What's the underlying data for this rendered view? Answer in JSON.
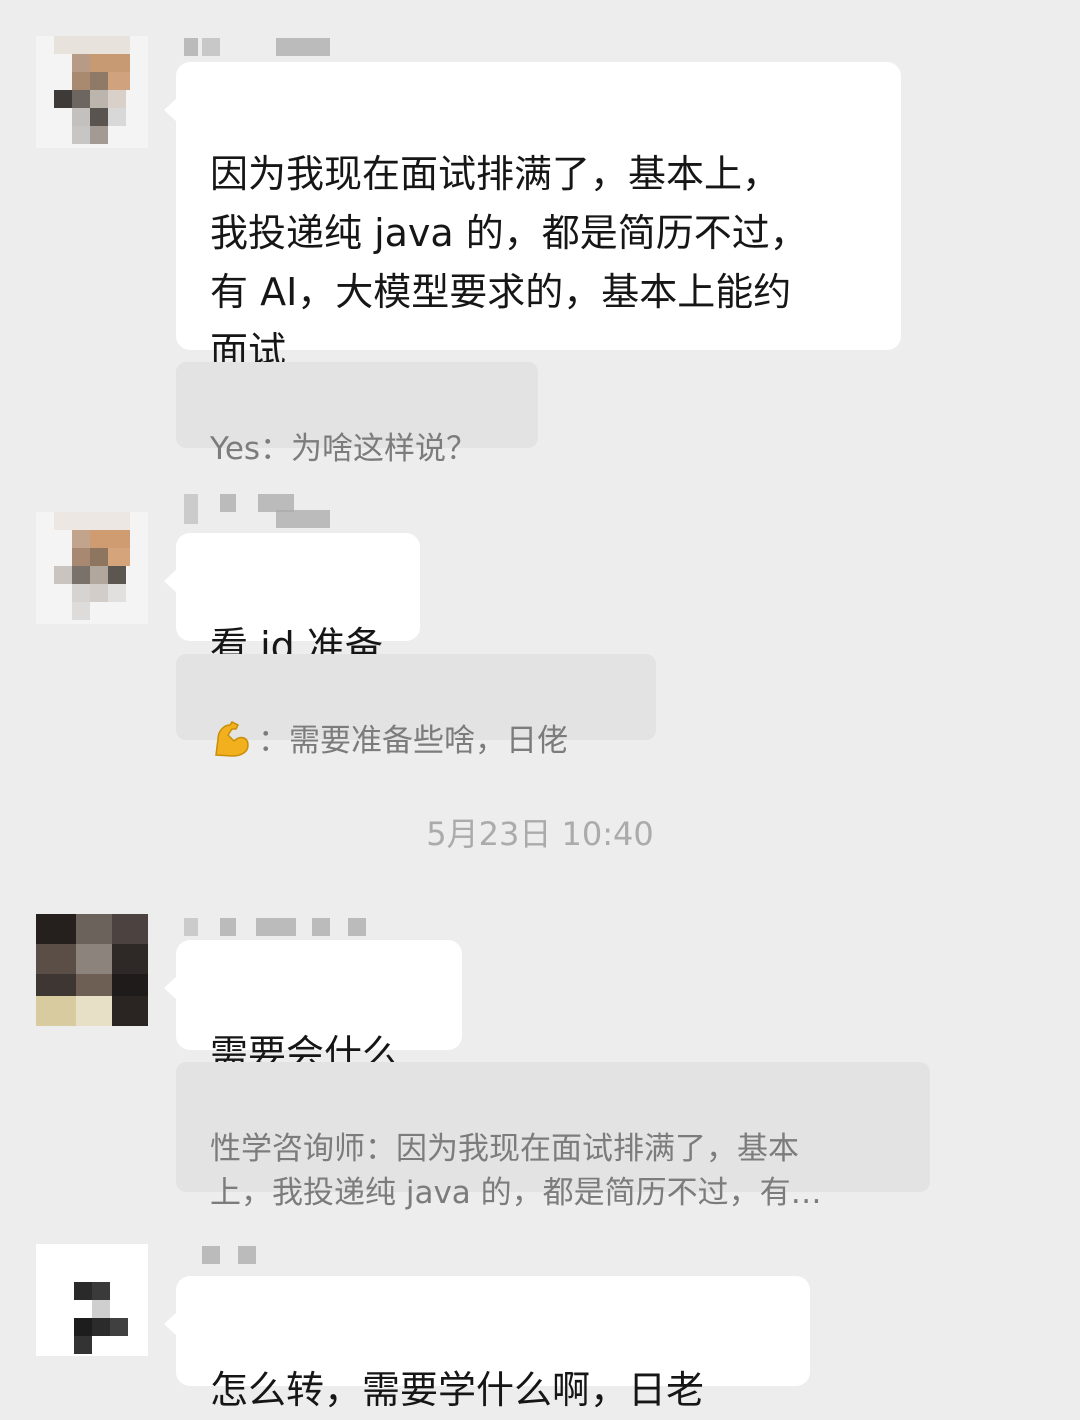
{
  "messages": [
    {
      "text": "因为我现在面试排满了，基本上，\n我投递纯 java 的，都是简历不过，\n有 AI，大模型要求的，基本上能约\n面试",
      "quote": "Yes：为啥这样说？"
    },
    {
      "text": "看 jd 准备",
      "quote_icon": "flexed-biceps-emoji",
      "quote_text": "：需要准备些啥，日佬"
    },
    {
      "text": "需要会什么",
      "quote": "性学咨询师：因为我现在面试排满了，基本\n上，我投递纯 java 的，都是简历不过，有…"
    },
    {
      "text": "怎么转，需要学什么啊，日老"
    }
  ],
  "timestamp": "5月23日 10:40",
  "colors": {
    "background": "#ededed",
    "bubble": "#ffffff",
    "quote_background": "#e3e3e3",
    "quote_text": "#7c7c7c",
    "timestamp_text": "#ababab"
  }
}
